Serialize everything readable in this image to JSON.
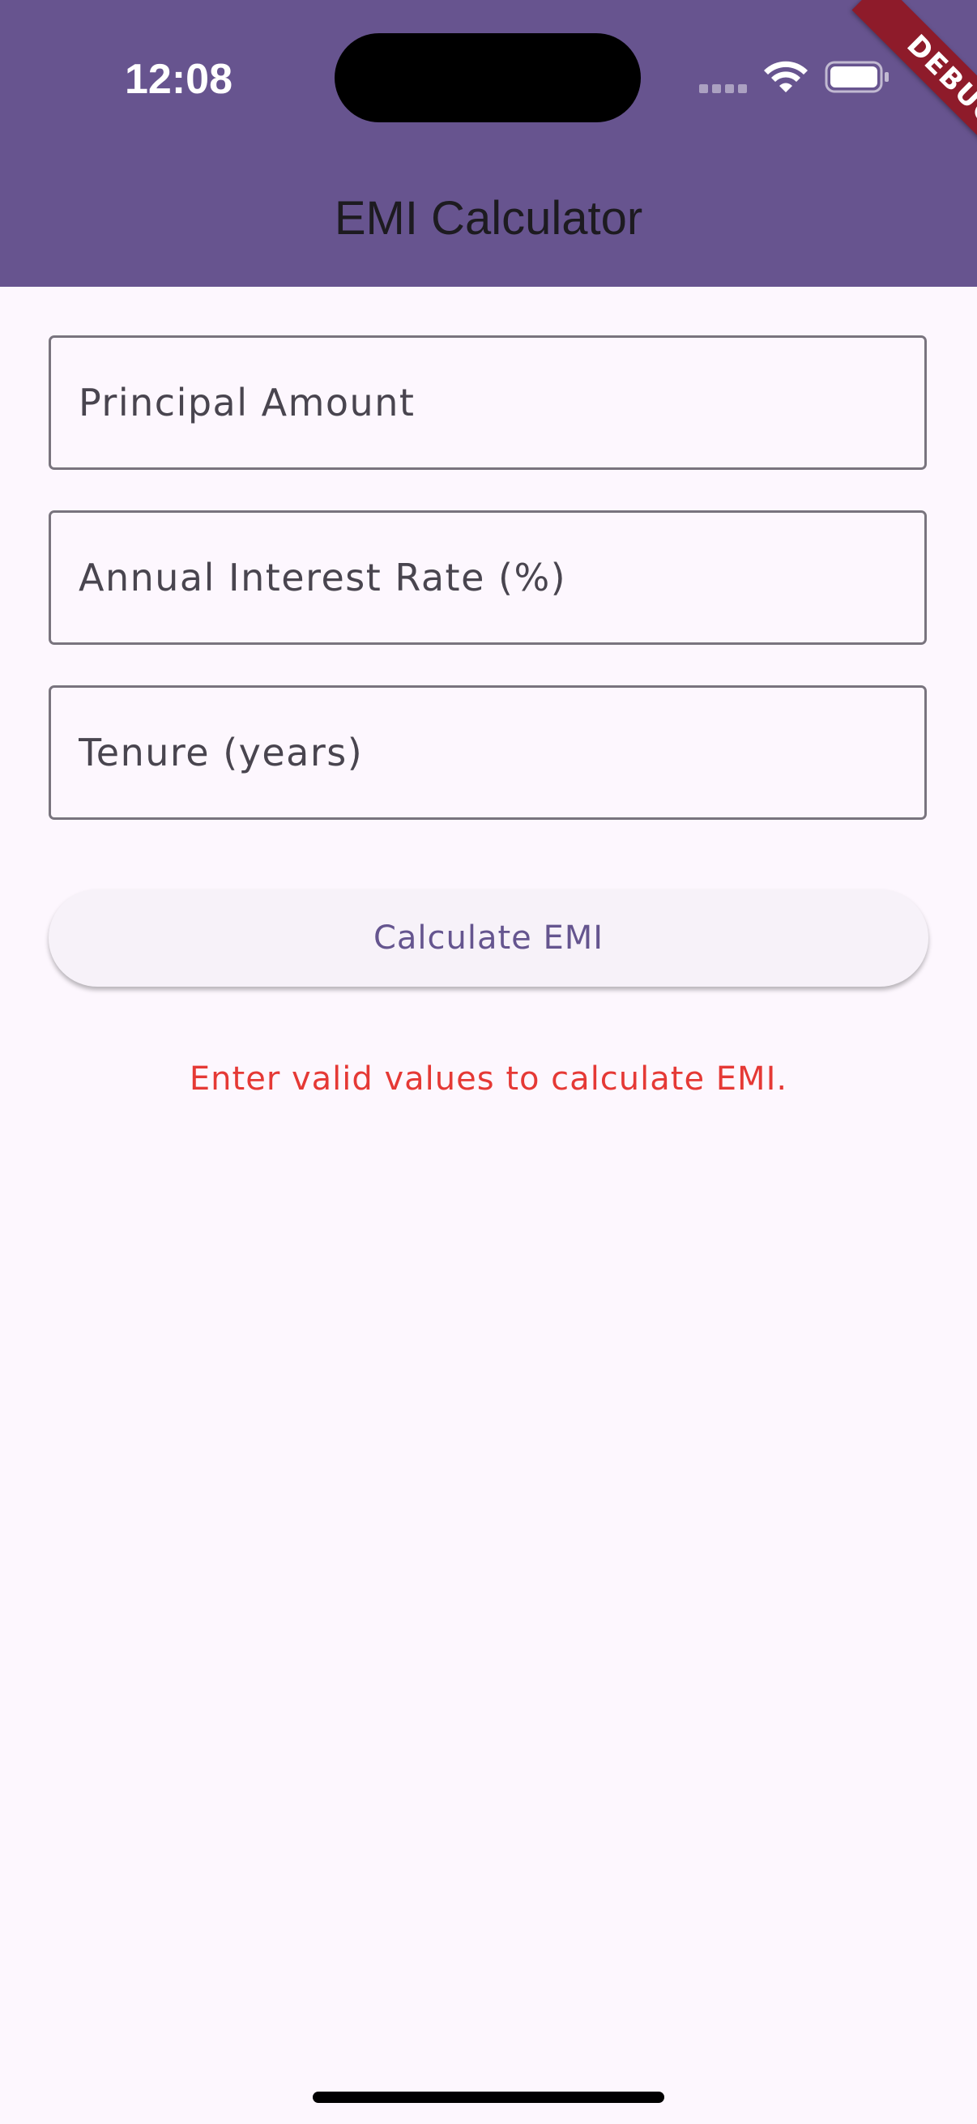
{
  "status_bar": {
    "time": "12:08"
  },
  "debug_banner": {
    "label": "DEBUG"
  },
  "app_bar": {
    "title": "EMI Calculator"
  },
  "form": {
    "principal": {
      "value": "",
      "placeholder": "Principal Amount"
    },
    "rate": {
      "value": "",
      "placeholder": "Annual Interest Rate (%)"
    },
    "tenure": {
      "value": "",
      "placeholder": "Tenure (years)"
    }
  },
  "actions": {
    "calculate_label": "Calculate EMI"
  },
  "result": {
    "message": "Enter valid values to calculate EMI."
  },
  "colors": {
    "app_bar": "#67548f",
    "background": "#fdf7fe",
    "button_text": "#65558f",
    "error": "#e53935",
    "debug_ribbon": "#8e1b2a"
  },
  "icons": [
    "signal-icon",
    "wifi-icon",
    "battery-icon"
  ]
}
